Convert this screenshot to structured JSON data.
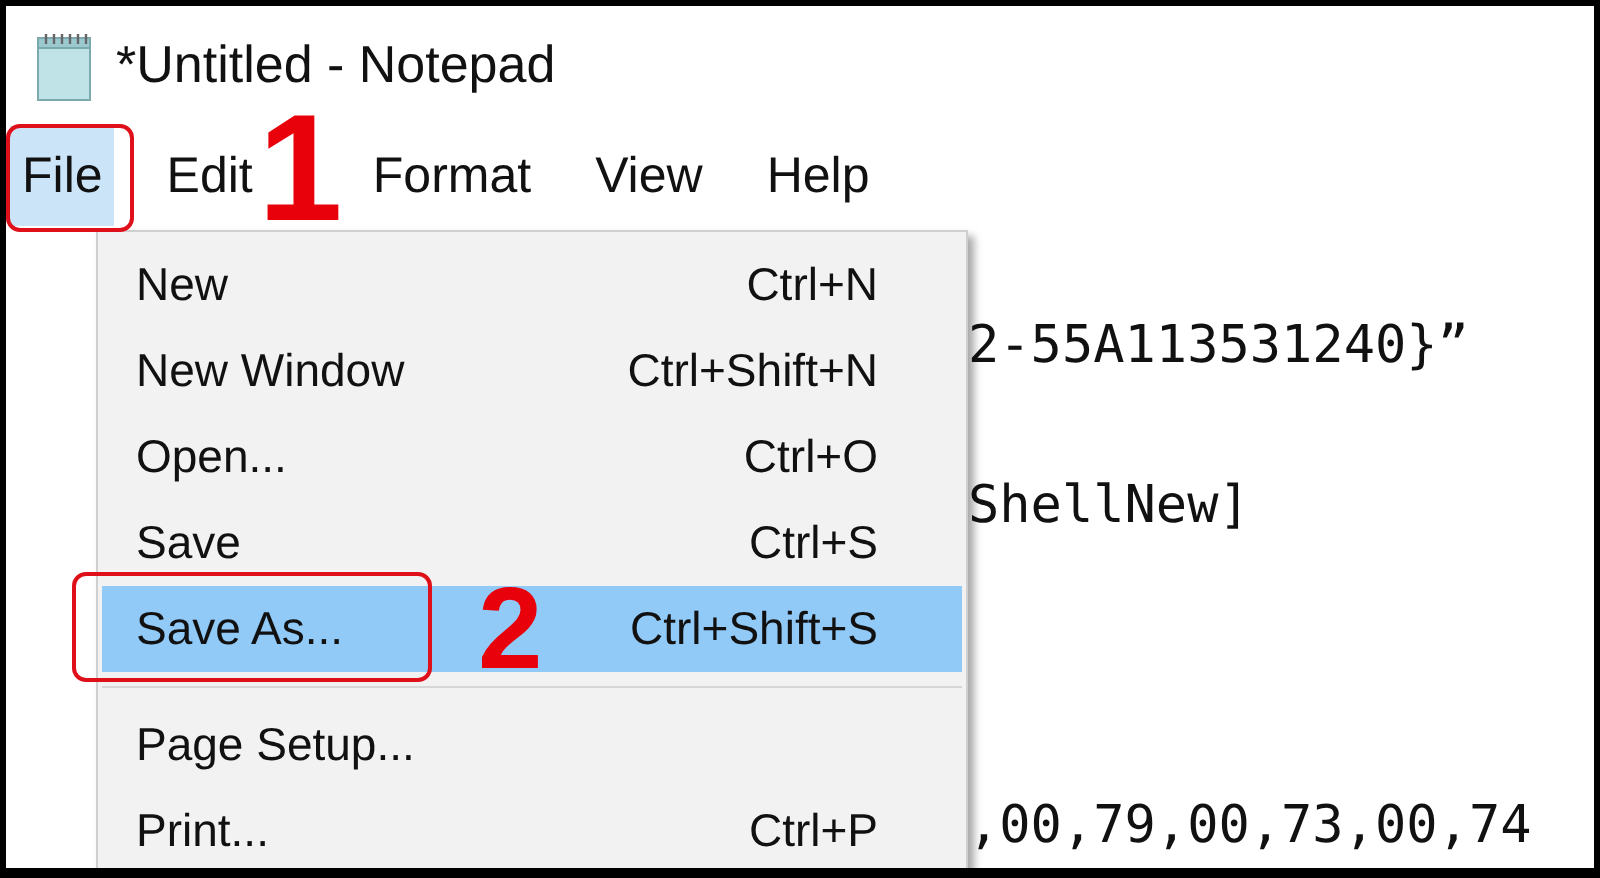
{
  "window": {
    "title": "*Untitled - Notepad"
  },
  "menu_bar": [
    {
      "label": "File",
      "selected": true
    },
    {
      "label": "Edit",
      "selected": false
    },
    {
      "label": "Format",
      "selected": false
    },
    {
      "label": "View",
      "selected": false
    },
    {
      "label": "Help",
      "selected": false
    }
  ],
  "editor": {
    "lines": [
      "2-55A113531240}”",
      "ShellNew]",
      ",00,79,00,73,00,74"
    ]
  },
  "file_menu": {
    "groups": [
      [
        {
          "label": "New",
          "shortcut": "Ctrl+N",
          "selected": false
        },
        {
          "label": "New Window",
          "shortcut": "Ctrl+Shift+N",
          "selected": false
        },
        {
          "label": "Open...",
          "shortcut": "Ctrl+O",
          "selected": false
        },
        {
          "label": "Save",
          "shortcut": "Ctrl+S",
          "selected": false
        },
        {
          "label": "Save As...",
          "shortcut": "Ctrl+Shift+S",
          "selected": true
        }
      ],
      [
        {
          "label": "Page Setup...",
          "selected": false
        },
        {
          "label": "Print...",
          "shortcut": "Ctrl+P",
          "selected": false
        }
      ]
    ]
  },
  "annotations": [
    {
      "step": "1"
    },
    {
      "step": "2"
    }
  ]
}
